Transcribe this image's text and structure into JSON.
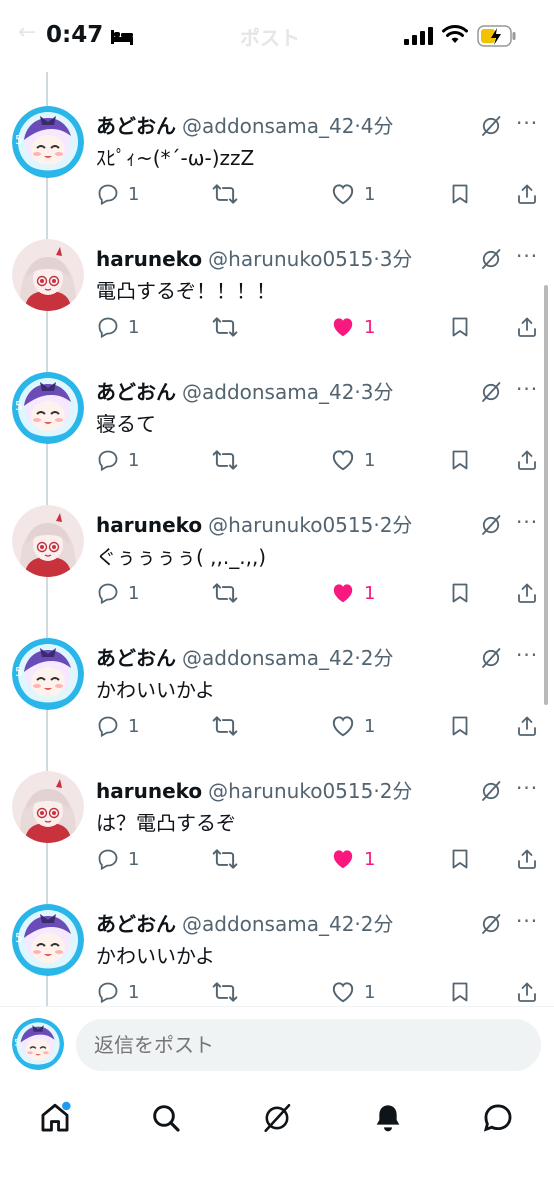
{
  "status_bar": {
    "time": "0:47",
    "header_title": "ポスト"
  },
  "colors": {
    "like_active": "#f91880",
    "icon_gray": "#536471",
    "thread_line": "#cfd9de"
  },
  "posts": [
    {
      "avatar_icon": "addon-avatar-icon",
      "display_name": "あどおん",
      "handle": "@addonsama_42",
      "time": "·4分",
      "text": "ｽﾋﾟｨ~(*´-ω-)zzZ",
      "replies": "1",
      "reposts": "",
      "likes": "1",
      "liked": false
    },
    {
      "avatar_icon": "haruneko-avatar-icon",
      "display_name": "haruneko",
      "handle": "@harunuko0515",
      "time": "·3分",
      "text": "電凸するぞ！！！！",
      "replies": "1",
      "reposts": "",
      "likes": "1",
      "liked": true
    },
    {
      "avatar_icon": "addon-avatar-icon",
      "display_name": "あどおん",
      "handle": "@addonsama_42",
      "time": "·3分",
      "text": "寝るて",
      "replies": "1",
      "reposts": "",
      "likes": "1",
      "liked": false
    },
    {
      "avatar_icon": "haruneko-avatar-icon",
      "display_name": "haruneko",
      "handle": "@harunuko0515",
      "time": "·2分",
      "text": "ぐぅぅぅぅ( ,,._.,,)",
      "replies": "1",
      "reposts": "",
      "likes": "1",
      "liked": true
    },
    {
      "avatar_icon": "addon-avatar-icon",
      "display_name": "あどおん",
      "handle": "@addonsama_42",
      "time": "·2分",
      "text": "かわいいかよ",
      "replies": "1",
      "reposts": "",
      "likes": "1",
      "liked": false
    },
    {
      "avatar_icon": "haruneko-avatar-icon",
      "display_name": "haruneko",
      "handle": "@harunuko0515",
      "time": "·2分",
      "text": "は？電凸するぞ",
      "replies": "1",
      "reposts": "",
      "likes": "1",
      "liked": true
    },
    {
      "avatar_icon": "addon-avatar-icon",
      "display_name": "あどおん",
      "handle": "@addonsama_42",
      "time": "·2分",
      "text": "かわいいかよ",
      "replies": "1",
      "reposts": "",
      "likes": "1",
      "liked": false
    }
  ],
  "compose": {
    "placeholder": "返信をポスト"
  },
  "tabs": [
    {
      "icon": "home-icon"
    },
    {
      "icon": "search-icon"
    },
    {
      "icon": "grok-icon"
    },
    {
      "icon": "notifications-icon"
    },
    {
      "icon": "messages-icon"
    }
  ]
}
